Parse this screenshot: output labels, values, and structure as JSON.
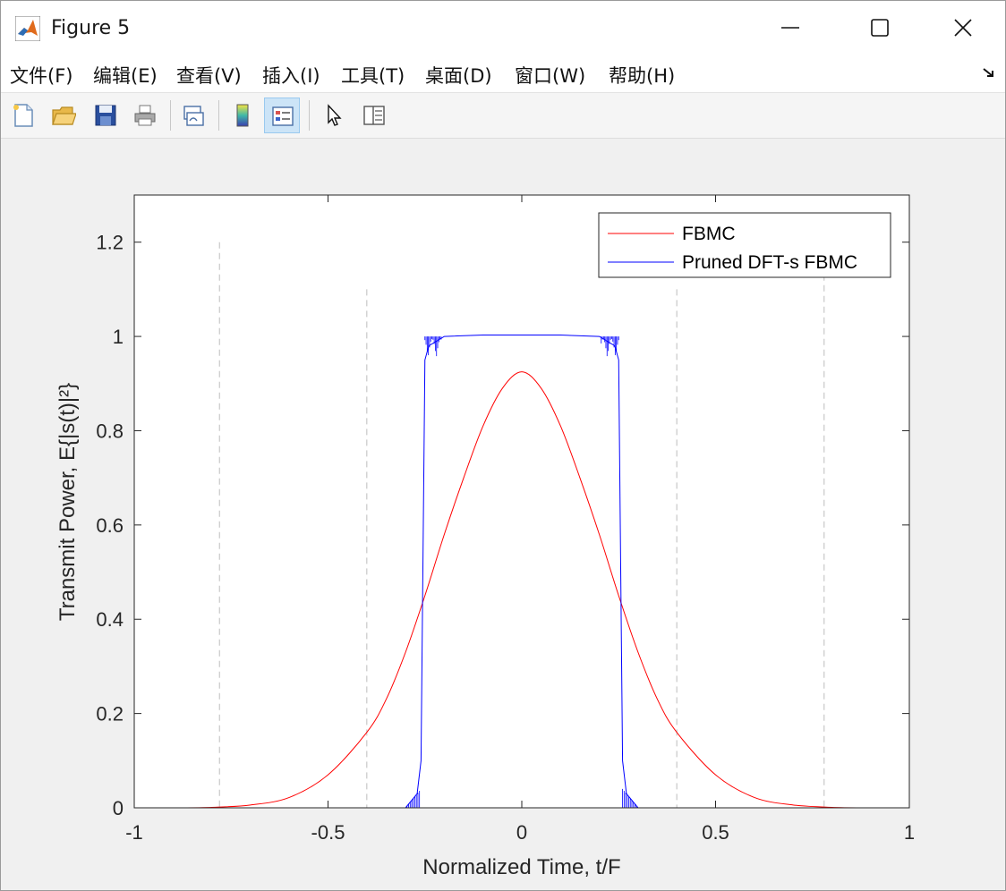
{
  "window": {
    "title": "Figure 5"
  },
  "menu": {
    "items": [
      "文件(F)",
      "编辑(E)",
      "查看(V)",
      "插入(I)",
      "工具(T)",
      "桌面(D)",
      "窗口(W)",
      "帮助(H)"
    ]
  },
  "toolbar": {
    "buttons": [
      "new-figure",
      "open-file",
      "save",
      "print",
      "link-plot",
      "colorbar",
      "legend",
      "edit-plot-arrow",
      "property-inspector"
    ]
  },
  "colors": {
    "fbmc": "#ff0000",
    "pruned": "#0000ff",
    "vline": "#c8c8c8",
    "axes": "#262626"
  },
  "chart_data": {
    "type": "line",
    "xlabel": "Normalized Time, t/F",
    "ylabel": "Transmit Power, E{|s(t)|²}",
    "xlim": [
      -1,
      1
    ],
    "ylim": [
      0,
      1.3
    ],
    "xticks": [
      "-1",
      "-0.5",
      "0",
      "0.5",
      "1"
    ],
    "yticks": [
      "0",
      "0.2",
      "0.4",
      "0.6",
      "0.8",
      "1",
      "1.2"
    ],
    "legend_position": "top-right",
    "series": [
      {
        "name": "FBMC",
        "color": "#ff0000",
        "x": [
          -1,
          -0.9,
          -0.8,
          -0.7,
          -0.6,
          -0.5,
          -0.4,
          -0.35,
          -0.3,
          -0.25,
          -0.2,
          -0.15,
          -0.1,
          -0.05,
          0,
          0.05,
          0.1,
          0.15,
          0.2,
          0.25,
          0.3,
          0.35,
          0.4,
          0.5,
          0.6,
          0.7,
          0.8,
          0.9,
          1
        ],
        "y": [
          0,
          0,
          0.001,
          0.006,
          0.022,
          0.07,
          0.16,
          0.23,
          0.33,
          0.45,
          0.58,
          0.7,
          0.81,
          0.89,
          0.925,
          0.89,
          0.81,
          0.7,
          0.58,
          0.45,
          0.33,
          0.23,
          0.16,
          0.07,
          0.022,
          0.006,
          0.001,
          0,
          0
        ]
      },
      {
        "name": "Pruned DFT-s FBMC",
        "color": "#0000ff",
        "x": [
          -1,
          -0.3,
          -0.27,
          -0.26,
          -0.25,
          -0.24,
          -0.2,
          -0.1,
          0,
          0.1,
          0.2,
          0.24,
          0.25,
          0.26,
          0.27,
          0.3,
          1
        ],
        "y": [
          0,
          0,
          0.03,
          0.1,
          0.95,
          0.98,
          1.0,
          1.003,
          1.003,
          1.003,
          1.0,
          0.98,
          0.95,
          0.1,
          0.03,
          0,
          0
        ]
      }
    ],
    "vertical_lines": [
      {
        "x": -0.78,
        "ymax": 1.2
      },
      {
        "x": -0.4,
        "ymax": 1.1
      },
      {
        "x": 0.4,
        "ymax": 1.1
      },
      {
        "x": 0.78,
        "ymax": 1.2
      }
    ]
  }
}
